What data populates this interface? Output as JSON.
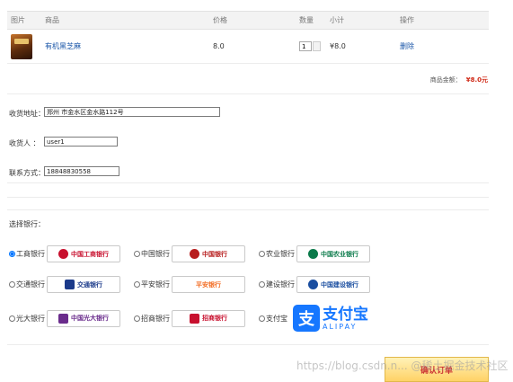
{
  "cart": {
    "headers": [
      "图片",
      "商品",
      "价格",
      "数量",
      "小计",
      "操作"
    ],
    "item": {
      "name": "有机黑芝麻",
      "price": "8.0",
      "quantity": "1",
      "subtotal": "¥8.0",
      "delete_label": "删除"
    }
  },
  "total": {
    "label": "商品金额：",
    "amount": "¥8.0元"
  },
  "form": {
    "address_label": "收货地址：",
    "address_value": "郑州 市金水区金水路112号",
    "receiver_label": "收货人  ：",
    "receiver_value": "user1",
    "phone_label": "联系方式：",
    "phone_value": "18848830558"
  },
  "bank_section_label": "选择银行：",
  "banks": [
    {
      "name": "工商银行",
      "logo": "中国工商银行",
      "color": "#c8102e",
      "selected": true
    },
    {
      "name": "中国银行",
      "logo": "中国银行",
      "color": "#b71c1c",
      "selected": false
    },
    {
      "name": "农业银行",
      "logo": "中国农业银行",
      "color": "#0a7a4a",
      "selected": false
    },
    {
      "name": "交通银行",
      "logo": "交通银行",
      "color": "#1b3a8a",
      "selected": false
    },
    {
      "name": "平安银行",
      "logo": "平安银行",
      "color": "#f26b21",
      "selected": false
    },
    {
      "name": "建设银行",
      "logo": "中国建设银行",
      "color": "#1a4ea0",
      "selected": false
    },
    {
      "name": "光大银行",
      "logo": "中国光大银行",
      "color": "#6a2c8c",
      "selected": false
    },
    {
      "name": "招商银行",
      "logo": "招商银行",
      "color": "#c8102e",
      "selected": false
    },
    {
      "name": "支付宝",
      "logo_cn": "支付宝",
      "logo_en": "ALIPAY",
      "color": "#1677ff",
      "selected": false
    }
  ],
  "confirm_label": "确认订单",
  "watermark": "https://blog.csdn.n... @稀土掘金技术社区"
}
